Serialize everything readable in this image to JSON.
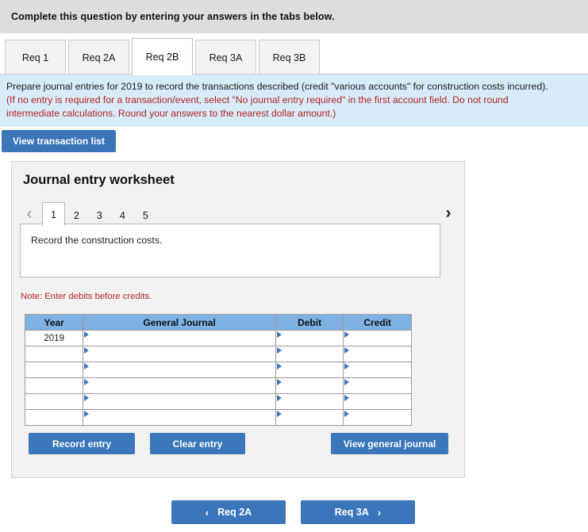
{
  "header": {
    "title": "Complete this question by entering your answers in the tabs below."
  },
  "tabs": [
    {
      "label": "Req 1",
      "active": false
    },
    {
      "label": "Req 2A",
      "active": false
    },
    {
      "label": "Req 2B",
      "active": true
    },
    {
      "label": "Req 3A",
      "active": false
    },
    {
      "label": "Req 3B",
      "active": false
    }
  ],
  "instructions": {
    "line1": "Prepare journal entries for 2019 to record the transactions described (credit \"various accounts\" for construction costs incurred).",
    "line2": "(If no entry is required for a transaction/event, select \"No journal entry required\" in the first account field. Do not round",
    "line3": "intermediate calculations. Round your answers to the nearest dollar amount.)"
  },
  "toolbar": {
    "view_transaction_list_label": "View transaction list"
  },
  "worksheet": {
    "title": "Journal entry worksheet",
    "pager": {
      "prev_icon": "chevron-left-icon",
      "next_icon": "chevron-right-icon",
      "prev_glyph": "‹",
      "next_glyph": "›",
      "pages": [
        "1",
        "2",
        "3",
        "4",
        "5"
      ],
      "active_page": "1"
    },
    "description": "Record the construction costs.",
    "note": "Note: Enter debits before credits.",
    "table": {
      "columns": [
        "Year",
        "General Journal",
        "Debit",
        "Credit"
      ],
      "rows": [
        {
          "year": "2019",
          "general_journal": "",
          "debit": "",
          "credit": ""
        },
        {
          "year": "",
          "general_journal": "",
          "debit": "",
          "credit": ""
        },
        {
          "year": "",
          "general_journal": "",
          "debit": "",
          "credit": ""
        },
        {
          "year": "",
          "general_journal": "",
          "debit": "",
          "credit": ""
        },
        {
          "year": "",
          "general_journal": "",
          "debit": "",
          "credit": ""
        },
        {
          "year": "",
          "general_journal": "",
          "debit": "",
          "credit": ""
        }
      ]
    },
    "actions": {
      "record_entry_label": "Record entry",
      "clear_entry_label": "Clear entry",
      "view_general_journal_label": "View general journal"
    }
  },
  "bottom_nav": {
    "prev_label": "Req 2A",
    "next_label": "Req 3A",
    "prev_glyph": "‹",
    "next_glyph": "›"
  },
  "colors": {
    "header_bg": "#dddddd",
    "instruction_bg": "#d7ebf9",
    "alert_text": "#b52222",
    "button_blue": "#3b76bb",
    "table_header_blue": "#7fb1e3",
    "panel_bg": "#f1f1f1"
  }
}
